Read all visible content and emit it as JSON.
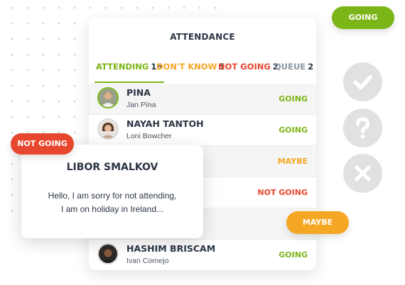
{
  "card": {
    "title": "ATTENDANCE",
    "tabs": [
      {
        "label": "ATTENDING",
        "count": "16",
        "color": "#7cb518",
        "active": true
      },
      {
        "label": "DON'T KNOW",
        "count": "5",
        "color": "#f5a623"
      },
      {
        "label": "NOT GOING",
        "count": "2",
        "color": "#e8472f"
      },
      {
        "label": "QUEUE",
        "count": "2",
        "color": "#8a96a3"
      }
    ],
    "rows": [
      {
        "name": "PINA",
        "sub": "Jan Pína",
        "status": "GOING"
      },
      {
        "name": "NAYAH TANTOH",
        "sub": "Loni Bowcher",
        "status": "GOING"
      },
      {
        "status": "MAYBE"
      },
      {
        "status": "NOT GOING"
      },
      {
        "status": ""
      },
      {
        "name": "HASHIM BRISCAM",
        "sub": "Ivan Cornejo",
        "status": "GOING"
      }
    ]
  },
  "pills": {
    "going": "GOING",
    "not_going": "NOT GOING",
    "maybe": "MAYBE"
  },
  "actions": [
    "check-icon",
    "question-icon",
    "close-icon"
  ],
  "popup": {
    "name": "LIBOR SMALKOV",
    "message_line1": "Hello, I am sorry for not attending,",
    "message_line2": "I am on holiday in Ireland..."
  },
  "colors": {
    "going": "#7cb518",
    "maybe": "#f5a623",
    "not_going": "#e8472f",
    "text_dark": "#2b3543",
    "action_bg": "#e1e1e1"
  }
}
